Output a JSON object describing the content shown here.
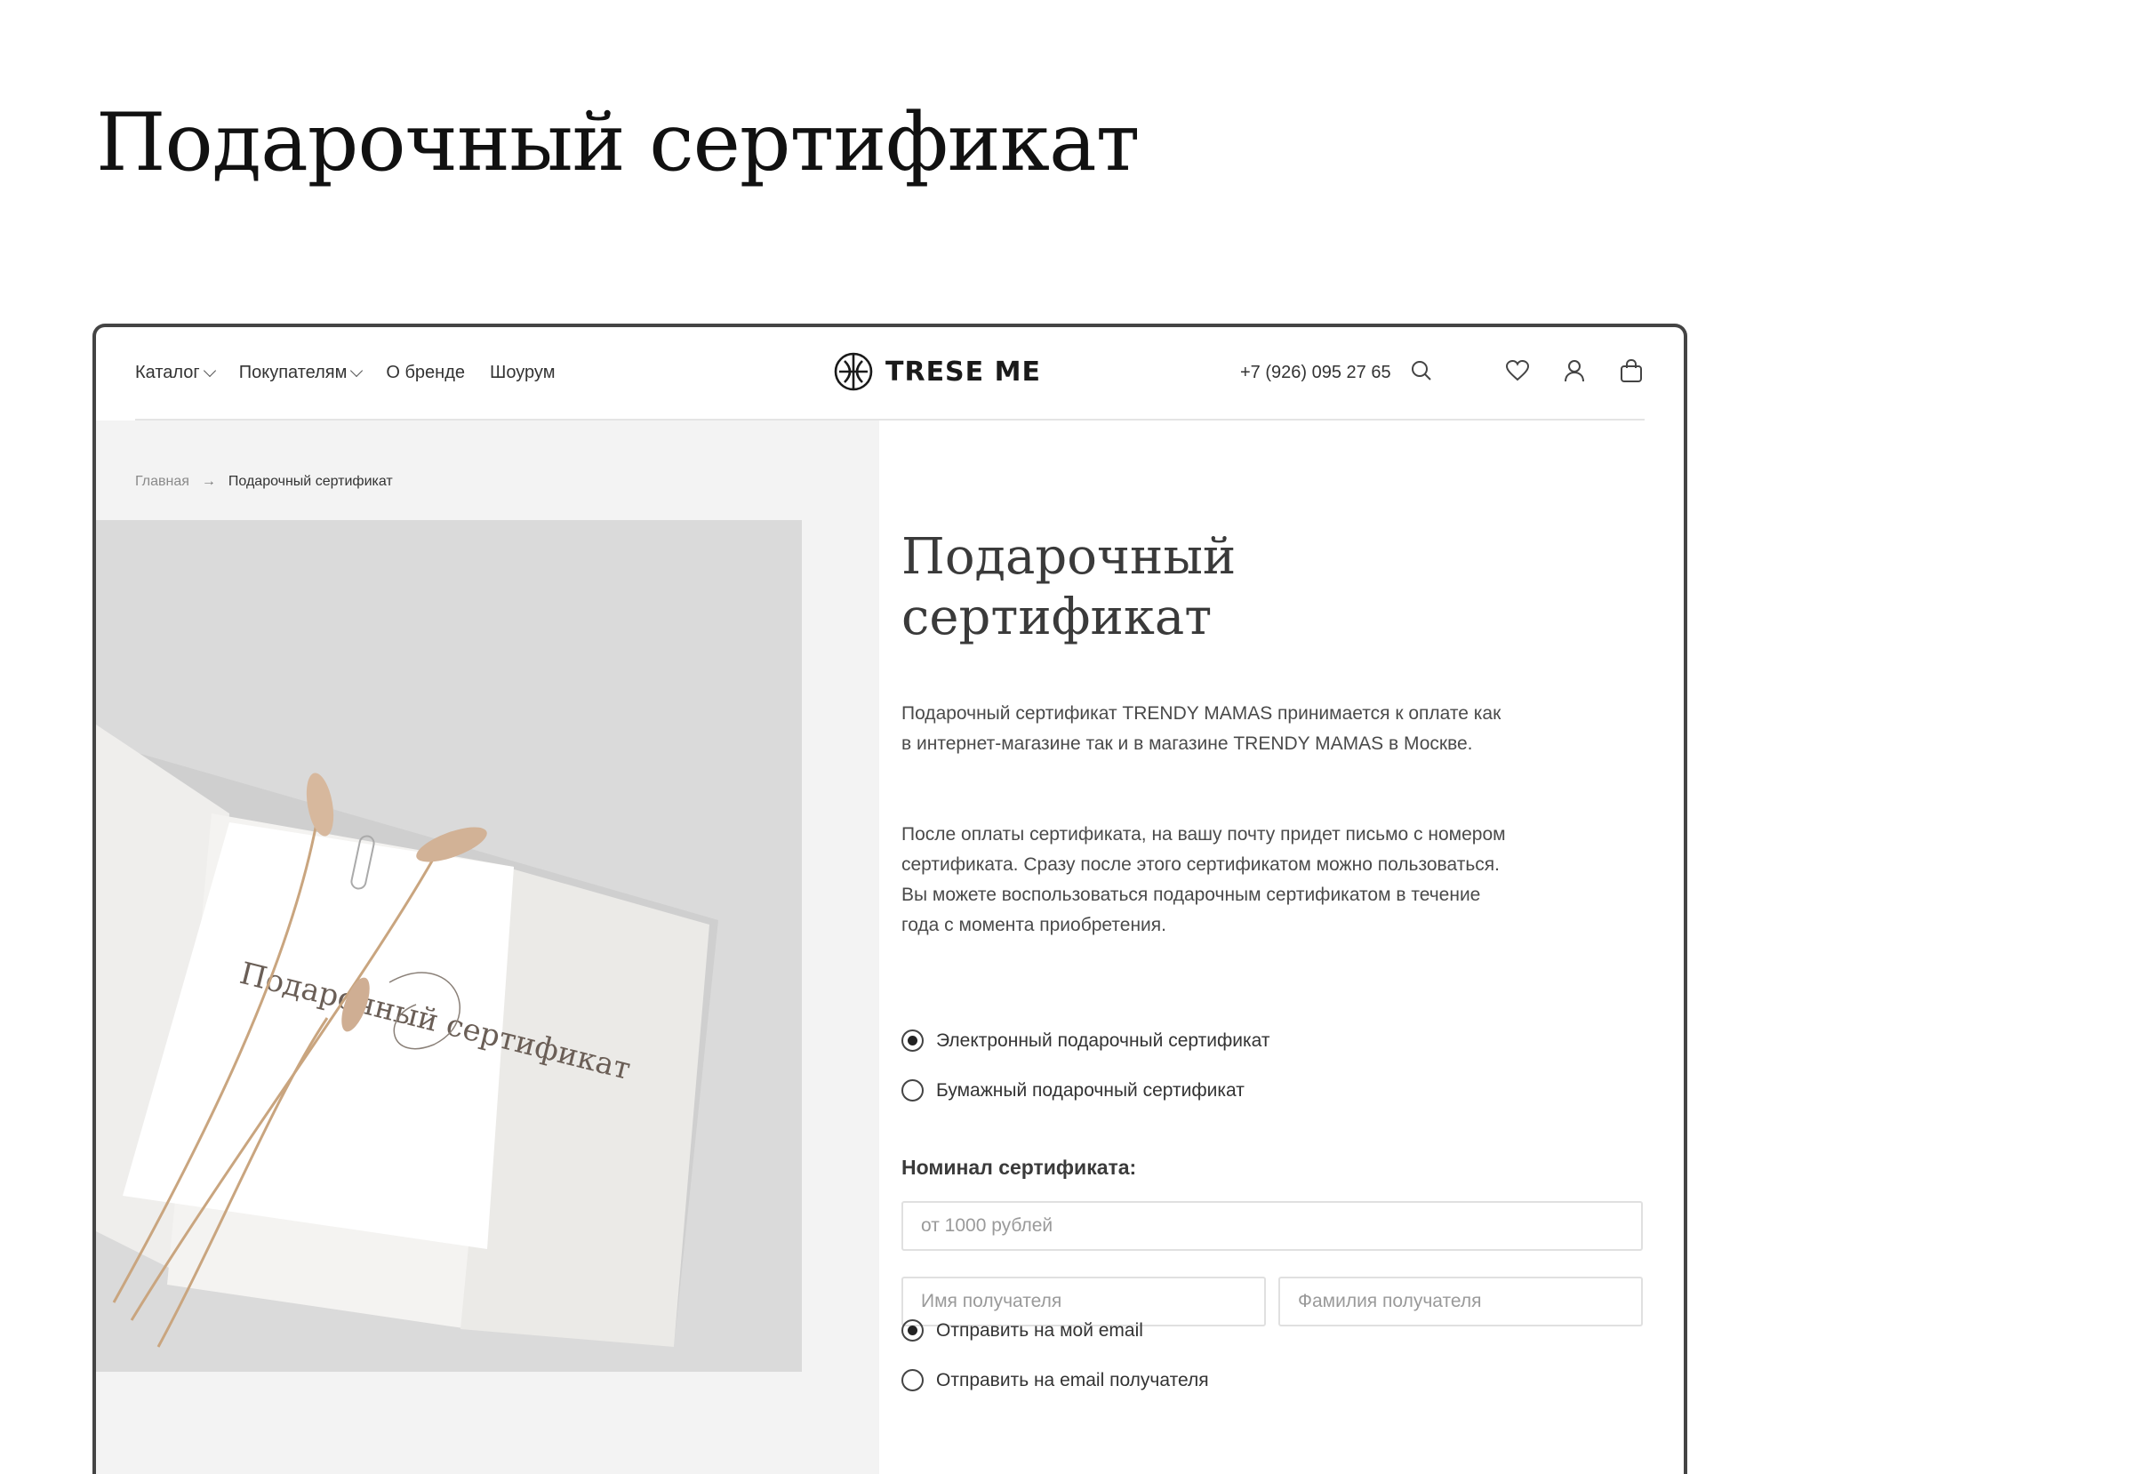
{
  "slide": {
    "title": "Подарочный сертификат"
  },
  "header": {
    "nav": [
      {
        "label": "Каталог",
        "dropdown": true
      },
      {
        "label": "Покупателям",
        "dropdown": true
      },
      {
        "label": "О бренде",
        "dropdown": false
      },
      {
        "label": "Шоурум",
        "dropdown": false
      }
    ],
    "logo_text": "TRESE ME",
    "phone": "+7 (926) 095 27 65",
    "icons": [
      "search-icon",
      "heart-icon",
      "user-icon",
      "bag-icon"
    ]
  },
  "breadcrumb": {
    "home": "Главная",
    "current": "Подарочный сертификат"
  },
  "product": {
    "title": "Подарочный сертификат",
    "description_1": "Подарочный сертификат TRENDY MAMAS принимается к оплате как в интернет-магазине так и в магазине TRENDY MAMAS в Москве.",
    "description_2": "После оплаты сертификата, на вашу почту придет письмо с номером сертификата. Сразу после этого сертификатом можно пользоваться. Вы можете воспользоваться подарочным сертификатом в течение года с момента приобретения.",
    "type_options": [
      {
        "label": "Электронный подарочный сертификат",
        "checked": true
      },
      {
        "label": "Бумажный подарочный сертификат",
        "checked": false
      }
    ],
    "nominal_label": "Номинал сертификата:",
    "amount_placeholder": "от 1000 рублей",
    "first_name_placeholder": "Имя получателя",
    "last_name_placeholder": "Фамилия получателя",
    "send_options": [
      {
        "label": "Отправить на мой email",
        "checked": true
      },
      {
        "label": "Отправить на email получателя",
        "checked": false
      }
    ]
  },
  "photo_card_text": "Подарочный сертификат",
  "colors": {
    "page_bg": "#ffffff",
    "panel_bg": "#f3f3f3",
    "photo_bg": "#dcdcdc",
    "text": "#333333"
  }
}
